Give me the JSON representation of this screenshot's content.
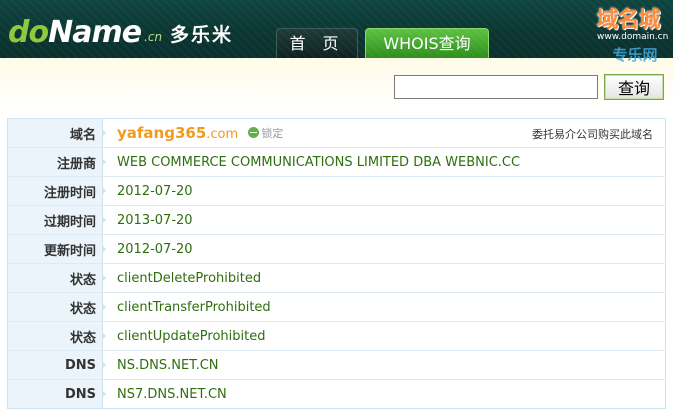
{
  "header": {
    "logo": {
      "part1": "do",
      "part2": "Name",
      "suffix": ".cn"
    },
    "brand_cn": "多乐米",
    "tabs": [
      {
        "label": "首 页",
        "active": false
      },
      {
        "label": "WHOIS查询",
        "active": true
      }
    ],
    "watermark": {
      "title": "域名城",
      "url": "www.domain.cn",
      "sub": "专乐网"
    }
  },
  "search": {
    "value": "",
    "placeholder": "",
    "button_label": "查询"
  },
  "whois": {
    "domain": {
      "label": "域名",
      "name": "yafang365",
      "tld": ".com",
      "lock_label": "锁定",
      "broker_link": "委托易介公司购买此域名"
    },
    "rows": [
      {
        "label": "注册商",
        "value": "WEB COMMERCE COMMUNICATIONS LIMITED DBA WEBNIC.CC"
      },
      {
        "label": "注册时间",
        "value": "2012-07-20"
      },
      {
        "label": "过期时间",
        "value": "2013-07-20"
      },
      {
        "label": "更新时间",
        "value": "2012-07-20"
      },
      {
        "label": "状态",
        "value": "clientDeleteProhibited"
      },
      {
        "label": "状态",
        "value": "clientTransferProhibited"
      },
      {
        "label": "状态",
        "value": "clientUpdateProhibited"
      },
      {
        "label": "DNS",
        "value": "NS.DNS.NET.CN"
      },
      {
        "label": "DNS",
        "value": "NS7.DNS.NET.CN"
      }
    ]
  },
  "colors": {
    "header_bg": "#0f4540",
    "accent_green": "#2c8c1c",
    "value_green": "#2f6e0f",
    "domain_orange": "#f39a1e",
    "label_bg": "#eaf4fa"
  }
}
